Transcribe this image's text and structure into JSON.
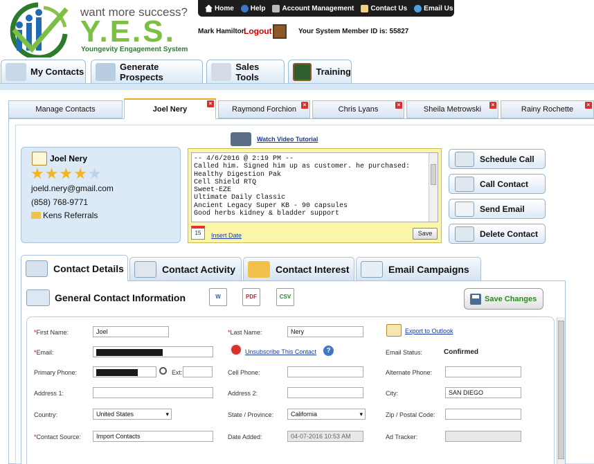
{
  "brand": {
    "tagline": "want more success?",
    "name": "Y.E.S.",
    "subtitle": "Youngevity Engagement System"
  },
  "topnav": [
    "Home",
    "Help",
    "Account Management",
    "Contact Us",
    "Email Us"
  ],
  "session": {
    "user": "Mark Hamilton",
    "logout": "Logout",
    "member_id_text": "Your System Member ID is: 55827"
  },
  "main_tabs": [
    "My Contacts",
    "Generate Prospects",
    "Sales Tools",
    "Training"
  ],
  "contact_tabs": [
    "Manage Contacts",
    "Joel Nery",
    "Raymond Forchion",
    "Chris Lyans",
    "Sheila Metrowski",
    "Rainy Rochette"
  ],
  "contact": {
    "name": "Joel Nery",
    "rating": 4,
    "rating_max": 5,
    "email": "joeld.nery@gmail.com",
    "phone": "(858) 768-9771",
    "group": "Kens Referrals"
  },
  "notes": {
    "video_link": "Watch Video Tutorial",
    "text": "-- 4/6/2016 @ 2:19 PM --\nCalled him. Signed him up as customer. he purchased:\nHealthy Digestion Pak\nCell Shield RTQ\nSweet-EZE\nUltimate Daily Classic\nAncient Legacy Super KB - 90 capsules\nGood herbs kidney & bladder support",
    "insert_date": "Insert Date",
    "calendar_day": "15",
    "save": "Save"
  },
  "actions": [
    "Schedule Call",
    "Call Contact",
    "Send Email",
    "Delete Contact"
  ],
  "sub_tabs": [
    "Contact Details",
    "Contact Activity",
    "Contact Interest",
    "Email Campaigns"
  ],
  "section": {
    "title": "General Contact Information",
    "export_word": "W",
    "export_pdf": "PDF",
    "export_csv": "CSV",
    "save_changes": "Save Changes"
  },
  "form": {
    "first_name_label": "First Name:",
    "first_name": "Joel",
    "last_name_label": "Last Name:",
    "last_name": "Nery",
    "export_outlook": "Export to Outlook",
    "email_label": "Email:",
    "unsubscribe": "Unsubscribe This Contact",
    "email_status_label": "Email Status:",
    "email_status": "Confirmed",
    "primary_phone_label": "Primary Phone:",
    "ext_label": "Ext:",
    "cell_phone_label": "Cell Phone:",
    "alt_phone_label": "Alternate Phone:",
    "address1_label": "Address 1:",
    "address2_label": "Address 2:",
    "city_label": "City:",
    "city": "SAN DIEGO",
    "country_label": "Country:",
    "country": "United States",
    "state_label": "State / Province:",
    "state": "California",
    "zip_label": "Zip / Postal Code:",
    "source_label": "Contact Source:",
    "source": "Import Contacts",
    "date_added_label": "Date Added:",
    "date_added": "04-07-2016 10:53 AM",
    "ad_tracker_label": "Ad Tracker:"
  },
  "colors": {
    "brand_green": "#7bc043",
    "link_blue": "#1a3a9a",
    "tab_blue": "#d6e6f4",
    "notes_yellow": "#fbf5a8",
    "logout_red": "#d80000",
    "star_gold": "#f2b51f"
  }
}
